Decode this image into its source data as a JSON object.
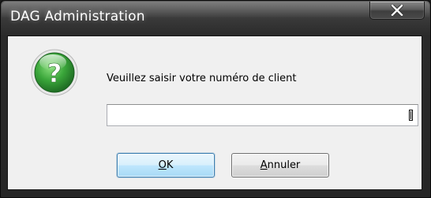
{
  "window": {
    "title": "DAG Administration",
    "close_icon": "close-x-icon"
  },
  "dialog": {
    "icon": "question-mark-icon",
    "prompt": "Veuillez saisir votre numéro de client",
    "input": {
      "value": "",
      "placeholder": ""
    }
  },
  "buttons": {
    "ok": {
      "mnemonic": "O",
      "rest": "K"
    },
    "cancel": {
      "mnemonic": "A",
      "rest": "nnuler"
    }
  },
  "colors": {
    "icon_green": "#3aa63a",
    "ok_border": "#3c7fb1",
    "client_bg": "#f0f0f0"
  }
}
